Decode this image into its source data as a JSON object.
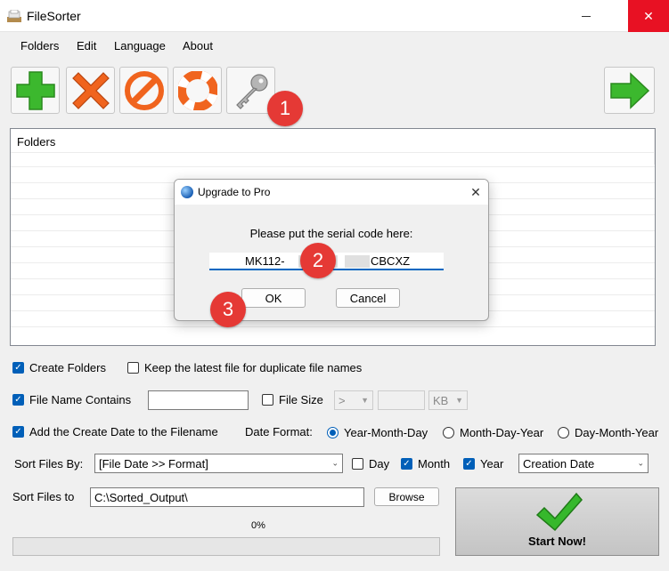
{
  "window": {
    "title": "FileSorter"
  },
  "menu": {
    "items": [
      "Folders",
      "Edit",
      "Language",
      "About"
    ]
  },
  "toolbar": {
    "buttons": [
      {
        "icon": "plus-icon",
        "color": "#3cb82e"
      },
      {
        "icon": "x-icon",
        "color": "#f0641e"
      },
      {
        "icon": "no-entry-icon",
        "color": "#f0641e"
      },
      {
        "icon": "lifebuoy-icon",
        "color": "#f0641e"
      },
      {
        "icon": "key-icon",
        "color": "#9e9e9e"
      },
      {
        "icon": "arrow-right-icon",
        "color": "#3cb82e"
      }
    ]
  },
  "badges": {
    "b1": "1",
    "b2": "2",
    "b3": "3"
  },
  "folders": {
    "header": "Folders"
  },
  "dialog": {
    "title": "Upgrade to Pro",
    "prompt": "Please put the serial code here:",
    "serial_prefix": "MK112-",
    "serial_suffix": "CBCXZ",
    "ok_label": "OK",
    "cancel_label": "Cancel"
  },
  "options": {
    "create_folders": {
      "label": "Create Folders",
      "checked": true
    },
    "keep_latest": {
      "label": "Keep the latest file for duplicate file names",
      "checked": false
    },
    "name_contains": {
      "label": "File Name Contains",
      "checked": true,
      "value": ""
    },
    "file_size": {
      "label": "File Size",
      "checked": false,
      "operator": ">",
      "value": "",
      "unit": "KB"
    },
    "add_date": {
      "label": "Add the Create Date to the Filename",
      "checked": true
    },
    "date_format": {
      "label": "Date Format:",
      "choices": [
        "Year-Month-Day",
        "Month-Day-Year",
        "Day-Month-Year"
      ],
      "selected": "Year-Month-Day"
    },
    "sort_by": {
      "label": "Sort Files By:",
      "value": "[File Date >> Format]",
      "day": {
        "label": "Day",
        "checked": false
      },
      "month": {
        "label": "Month",
        "checked": true
      },
      "year": {
        "label": "Year",
        "checked": true
      },
      "date_type": "Creation Date"
    },
    "sort_to": {
      "label": "Sort Files to",
      "path": "C:\\Sorted_Output\\",
      "browse_label": "Browse"
    }
  },
  "start": {
    "label": "Start Now!",
    "check_color": "#36b82c"
  },
  "progress": {
    "text": "0%",
    "value": 0
  }
}
